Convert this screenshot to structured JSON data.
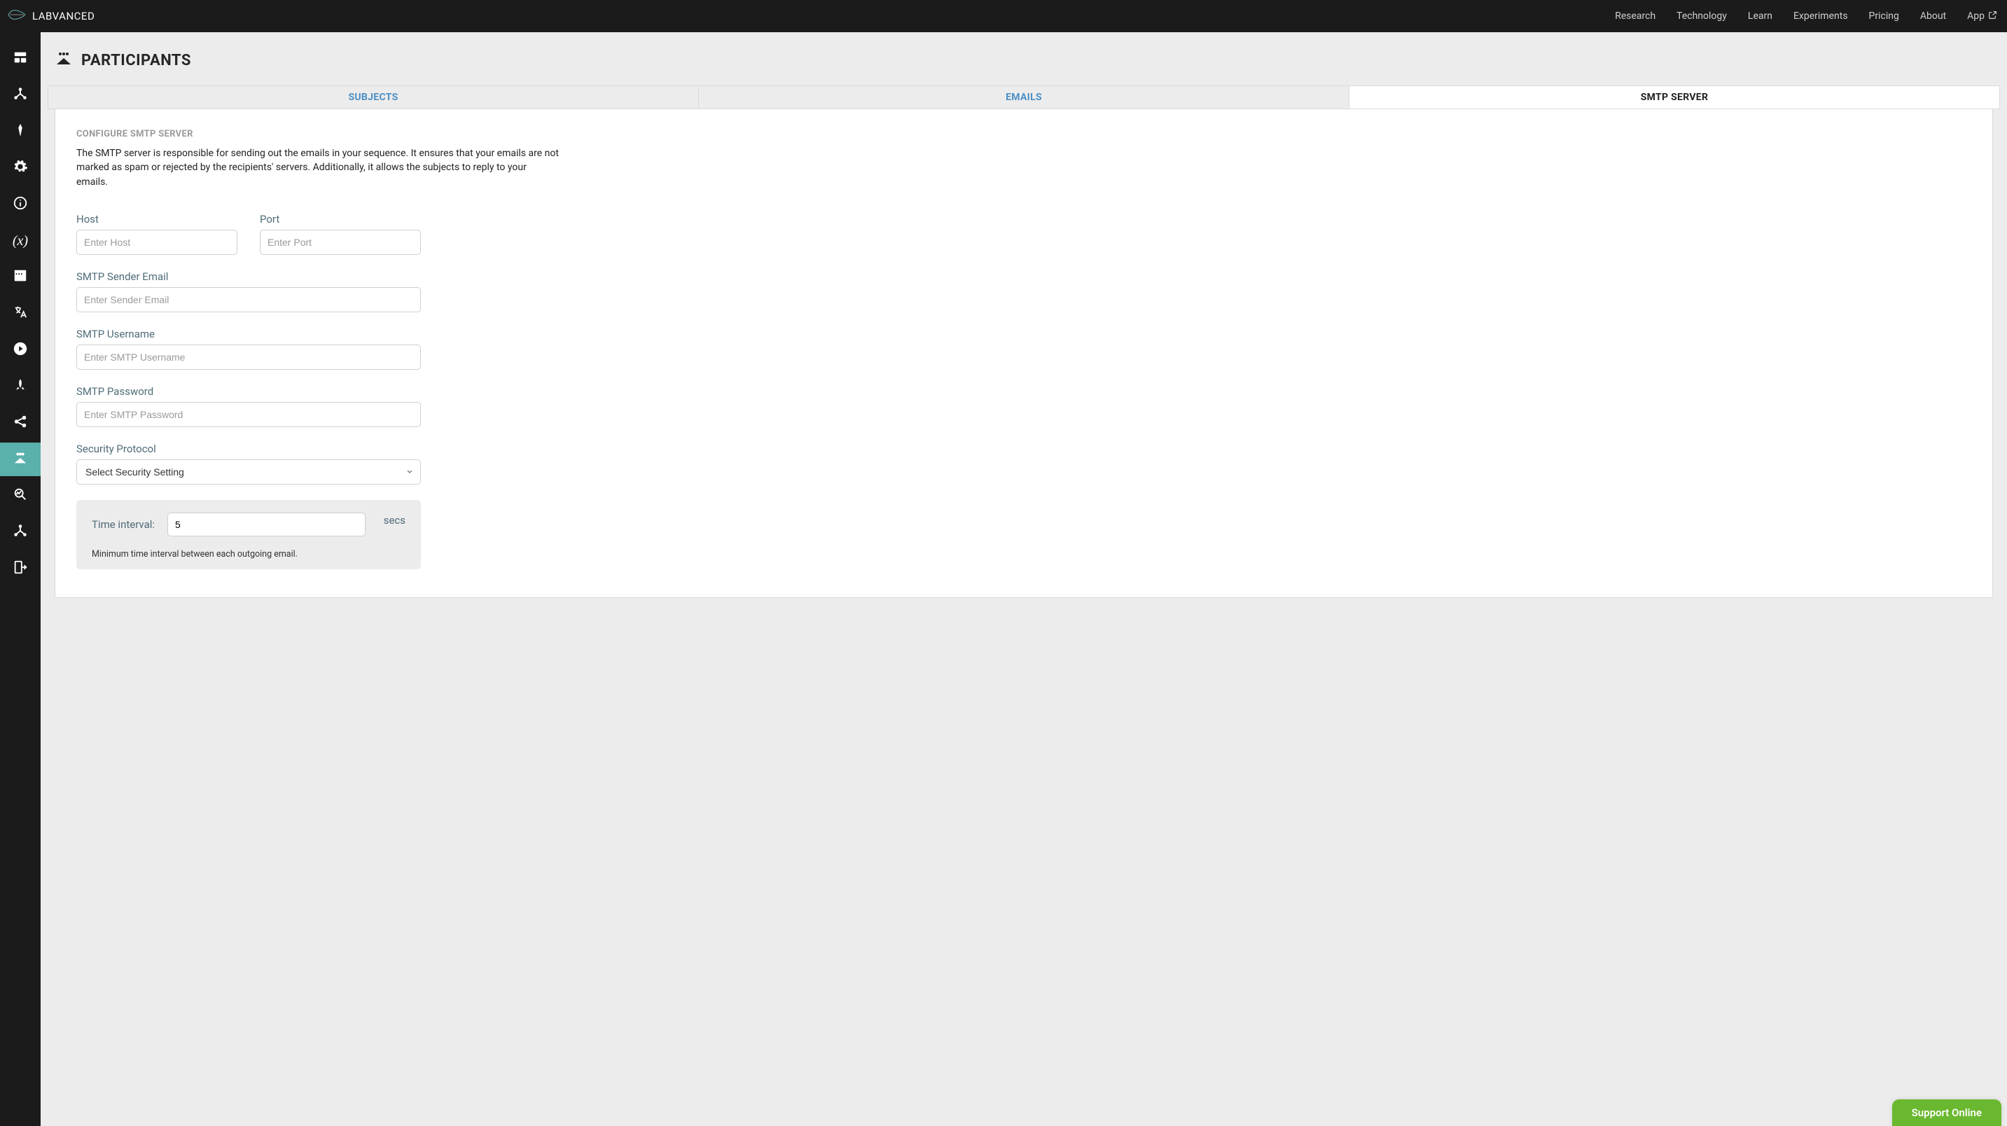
{
  "brand": {
    "name": "LABVANCED"
  },
  "topnav": {
    "research": "Research",
    "technology": "Technology",
    "learn": "Learn",
    "experiments": "Experiments",
    "pricing": "Pricing",
    "about": "About",
    "app": "App"
  },
  "page": {
    "title": "PARTICIPANTS"
  },
  "tabs": {
    "subjects": "SUBJECTS",
    "emails": "EMAILS",
    "smtp": "SMTP SERVER"
  },
  "smtp": {
    "section_title": "CONFIGURE SMTP SERVER",
    "description": "The SMTP server is responsible for sending out the emails in your sequence. It ensures that your emails are not marked as spam or rejected by the recipients' servers. Additionally, it allows the subjects to reply to your emails.",
    "host": {
      "label": "Host",
      "placeholder": "Enter Host",
      "value": ""
    },
    "port": {
      "label": "Port",
      "placeholder": "Enter Port",
      "value": ""
    },
    "sender": {
      "label": "SMTP Sender Email",
      "placeholder": "Enter Sender Email",
      "value": ""
    },
    "username": {
      "label": "SMTP Username",
      "placeholder": "Enter SMTP Username",
      "value": ""
    },
    "password": {
      "label": "SMTP Password",
      "placeholder": "Enter SMTP Password",
      "value": ""
    },
    "security": {
      "label": "Security Protocol",
      "selected": "Select Security Setting"
    },
    "interval": {
      "label": "Time interval:",
      "value": "5",
      "unit": "secs",
      "help": "Minimum time interval between each outgoing email."
    }
  },
  "support": {
    "label": "Support Online"
  },
  "sidebar_icons": {
    "dashboard": "dashboard-icon",
    "structure": "structure-icon",
    "design": "design-icon",
    "settings": "gear-icon",
    "info": "info-icon",
    "variables": "variables-icon",
    "media": "media-icon",
    "translate": "translate-icon",
    "run": "play-icon",
    "publish": "rocket-icon",
    "share": "share-icon",
    "participants": "participants-icon",
    "analyze": "analyze-icon",
    "export": "export-icon",
    "logout": "logout-icon"
  }
}
